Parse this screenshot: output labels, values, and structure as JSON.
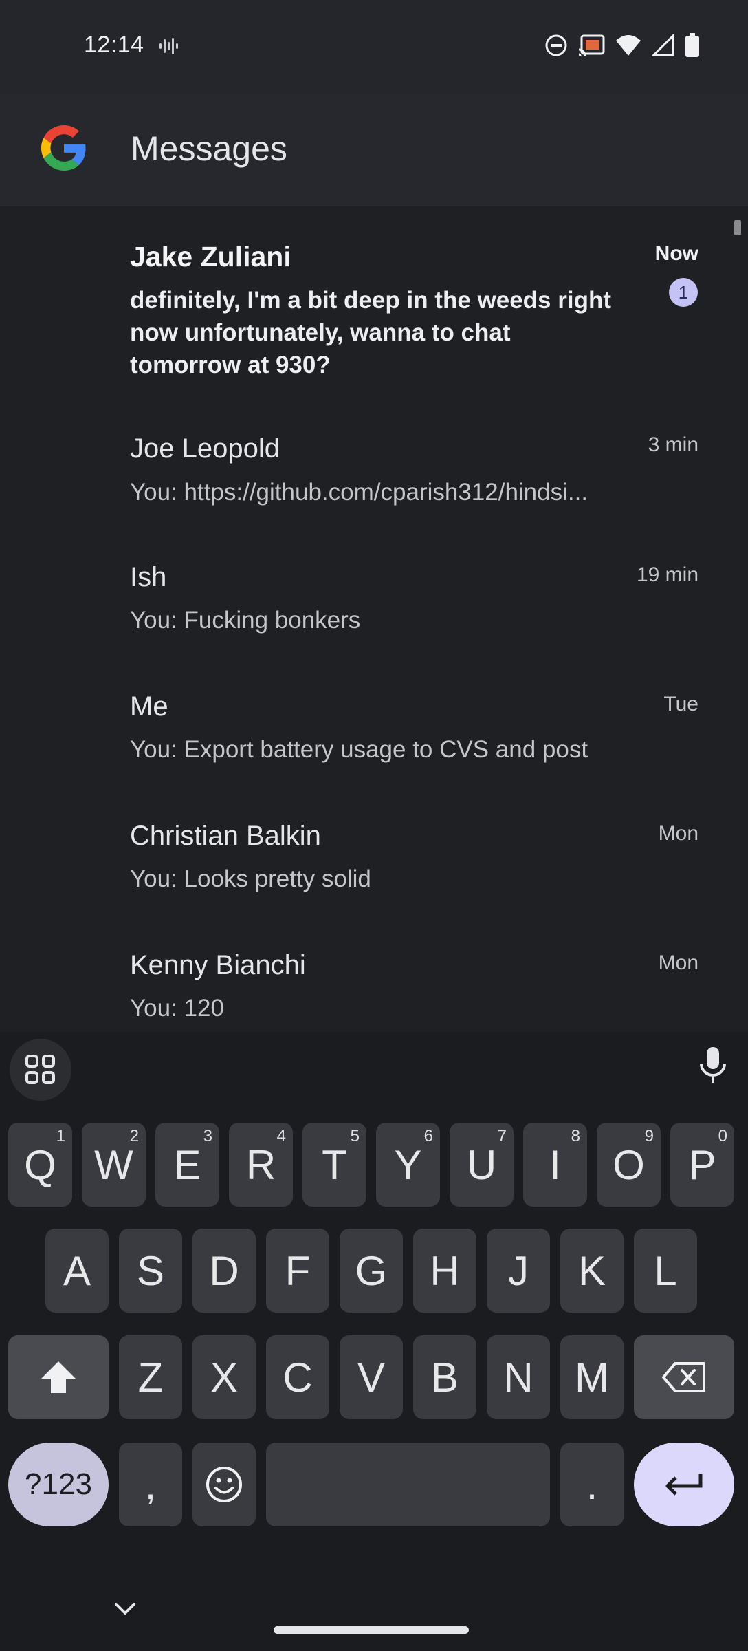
{
  "status_bar": {
    "time": "12:14",
    "icons": [
      "voice-wave-icon",
      "do-not-disturb-icon",
      "cast-icon",
      "wifi-icon",
      "signal-icon",
      "battery-icon"
    ]
  },
  "app_bar": {
    "logo": "google-g-logo",
    "title": "Messages"
  },
  "conversations": [
    {
      "name": "Jake Zuliani",
      "snippet": "definitely, I'm a bit deep in the weeds right now unfortunately, wanna to chat tomorrow at 930?",
      "time": "Now",
      "unread": true,
      "unread_count": "1"
    },
    {
      "name": "Joe Leopold",
      "snippet": "You: https://github.com/cparish312/hindsi...",
      "time": "3 min",
      "unread": false
    },
    {
      "name": "Ish",
      "snippet": "You: Fucking bonkers",
      "time": "19 min",
      "unread": false
    },
    {
      "name": "Me",
      "snippet": "You: Export battery usage to CVS and post",
      "time": "Tue",
      "unread": false
    },
    {
      "name": "Christian Balkin",
      "snippet": "You: Looks pretty solid",
      "time": "Mon",
      "unread": false
    },
    {
      "name": "Kenny Bianchi",
      "snippet": "You: 120",
      "time": "Mon",
      "unread": false
    }
  ],
  "keyboard": {
    "row1": [
      {
        "label": "Q",
        "hint": "1"
      },
      {
        "label": "W",
        "hint": "2"
      },
      {
        "label": "E",
        "hint": "3"
      },
      {
        "label": "R",
        "hint": "4"
      },
      {
        "label": "T",
        "hint": "5"
      },
      {
        "label": "Y",
        "hint": "6"
      },
      {
        "label": "U",
        "hint": "7"
      },
      {
        "label": "I",
        "hint": "8"
      },
      {
        "label": "O",
        "hint": "9"
      },
      {
        "label": "P",
        "hint": "0"
      }
    ],
    "row2": [
      "A",
      "S",
      "D",
      "F",
      "G",
      "H",
      "J",
      "K",
      "L"
    ],
    "row3": [
      "Z",
      "X",
      "C",
      "V",
      "B",
      "N",
      "M"
    ],
    "symbols_label": "?123",
    "comma_label": ",",
    "period_label": ".",
    "colors": {
      "enter": "#dcd8fb",
      "symbols": "#c6c4dc",
      "key": "#3a3b40"
    }
  }
}
